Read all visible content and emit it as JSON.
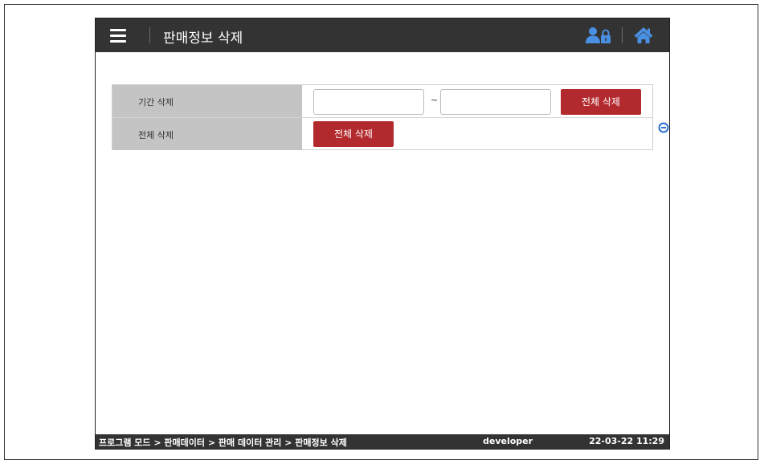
{
  "header": {
    "title": "판매정보 삭제",
    "menu_icon": "hamburger-menu-icon",
    "user_icon": "user-lock-icon",
    "home_icon": "home-icon",
    "bar_color": "#333333",
    "icon_color": "#4a90e2"
  },
  "form": {
    "period_row": {
      "label": "기간 삭제",
      "start_value": "",
      "separator": "~",
      "end_value": "",
      "button_label": "전체 삭제"
    },
    "all_row": {
      "label": "전체 삭제",
      "button_label": "전체 삭제"
    },
    "button_color": "#b32a2e",
    "label_bg_color": "#c4c4c4",
    "collapse_icon": "collapse-minus-icon"
  },
  "status_bar": {
    "breadcrumb": "프로그램 모드 > 판매데이터 > 판매 데이터 관리 > 판매정보 삭제",
    "user": "developer",
    "datetime": "22-03-22 11:29"
  }
}
